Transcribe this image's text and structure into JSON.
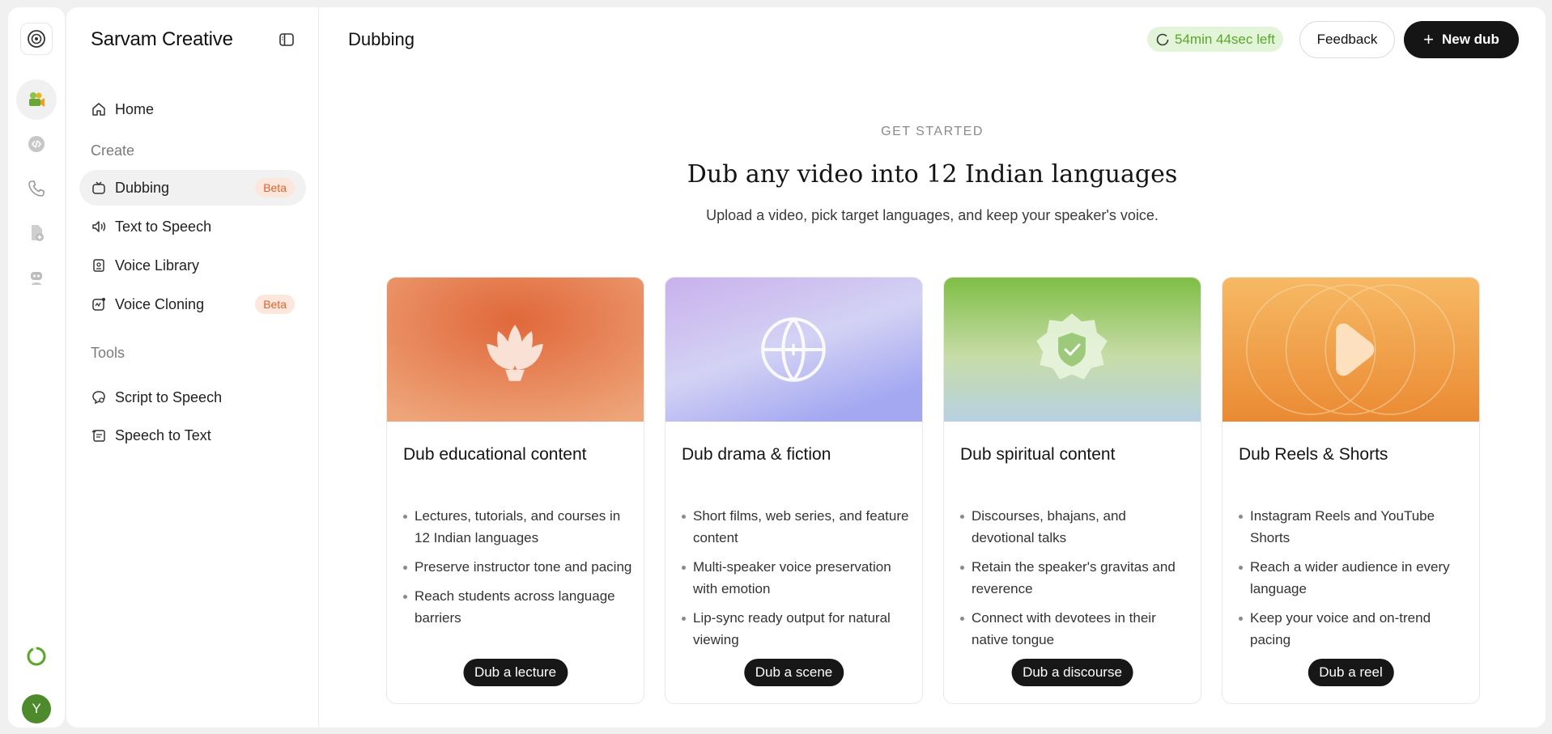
{
  "app": {
    "brand": "Sarvam Creative",
    "page_title": "Dubbing",
    "avatar_letter": "Y"
  },
  "rail": {
    "icons": [
      "sarvam-logo-icon",
      "film-camera-icon",
      "code-icon",
      "phone-icon",
      "document-plus-icon",
      "robot-icon",
      "progress-ring-icon"
    ]
  },
  "sidebar": {
    "home_label": "Home",
    "create_label": "Create",
    "create_items": [
      {
        "label": "Dubbing",
        "badge": "Beta",
        "icon": "tv-icon"
      },
      {
        "label": "Text to Speech",
        "icon": "speaker-icon"
      },
      {
        "label": "Voice Library",
        "icon": "book-icon"
      },
      {
        "label": "Voice Cloning",
        "badge": "Beta",
        "icon": "clone-icon"
      }
    ],
    "tools_label": "Tools",
    "tool_items": [
      {
        "label": "Script to Speech",
        "icon": "chat-icon"
      },
      {
        "label": "Speech to Text",
        "icon": "transcript-icon"
      }
    ]
  },
  "header": {
    "timer": "54min 44sec left",
    "feedback_label": "Feedback",
    "new_dub_label": "New dub"
  },
  "hero": {
    "eyebrow": "GET STARTED",
    "title": "Dub any video into 12 Indian languages",
    "subtitle": "Upload a video, pick target languages, and keep your speaker's voice."
  },
  "cards": [
    {
      "title": "Dub educational content",
      "bullets": [
        "Lectures, tutorials, and courses in 12 Indian languages",
        "Preserve instructor tone and pacing",
        "Reach students across language barriers"
      ],
      "button": "Dub a lecture",
      "icon": "lotus-icon",
      "colors": [
        "#e0683a",
        "#eea57a"
      ]
    },
    {
      "title": "Dub drama & fiction",
      "bullets": [
        "Short films, web series, and feature content",
        "Multi-speaker voice preservation with emotion",
        "Lip-sync ready output for natural viewing"
      ],
      "button": "Dub a scene",
      "icon": "globe-icon",
      "colors": [
        "#c9b1ec",
        "#a3a8f1"
      ]
    },
    {
      "title": "Dub spiritual content",
      "bullets": [
        "Discourses, bhajans, and devotional talks",
        "Retain the speaker's gravitas and reverence",
        "Connect with devotees in their native tongue"
      ],
      "button": "Dub a discourse",
      "icon": "shield-check-icon",
      "colors": [
        "#7fbe45",
        "#b7d0e2"
      ]
    },
    {
      "title": "Dub Reels & Shorts",
      "bullets": [
        "Instagram Reels and YouTube Shorts",
        "Reach a wider audience in every language",
        "Keep your voice and on-trend pacing"
      ],
      "button": "Dub a reel",
      "icon": "play-icon",
      "colors": [
        "#f7b964",
        "#ea8a33"
      ]
    }
  ]
}
